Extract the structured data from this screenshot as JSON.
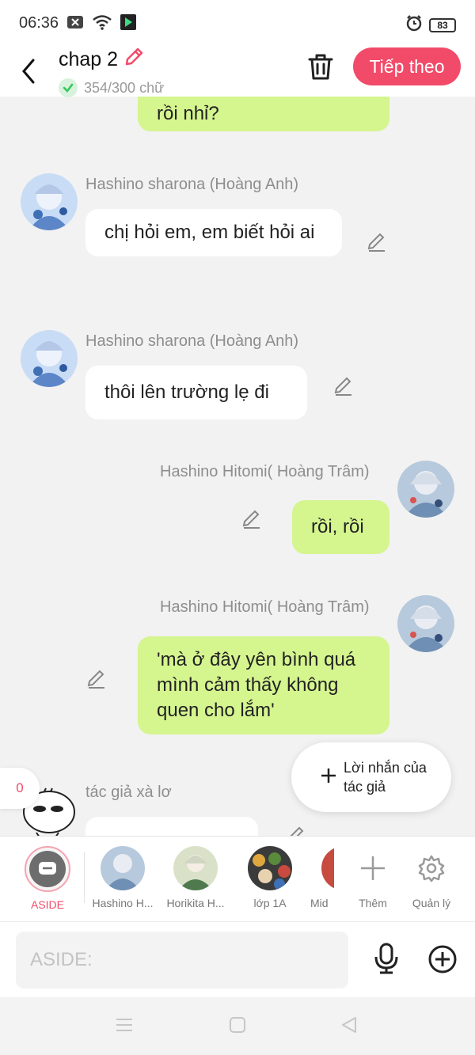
{
  "status": {
    "time": "06:36",
    "battery": "83"
  },
  "header": {
    "title": "chap 2",
    "word_count": "354/300 chữ",
    "next_label": "Tiếp theo"
  },
  "messages": [
    {
      "text": "rồi nhỉ?"
    },
    {
      "name": "Hashino sharona (Hoàng Anh)",
      "text": "chị hỏi em, em biết hỏi ai"
    },
    {
      "name": "Hashino sharona (Hoàng Anh)",
      "text": "thôi lên trường lẹ đi"
    },
    {
      "name": "Hashino Hitomi( Hoàng Trâm)",
      "text": "rồi, rồi"
    },
    {
      "name": "Hashino Hitomi( Hoàng Trâm)",
      "text": "'mà ở đây yên bình quá mình cảm thấy không quen cho lắm'"
    },
    {
      "name": "tác giả xà lơ",
      "text": ""
    }
  ],
  "fab": {
    "label": "Lời nhắn của tác giả"
  },
  "badge_count": "0",
  "characters": [
    {
      "label": "ASIDE"
    },
    {
      "label": "Hashino H..."
    },
    {
      "label": "Horikita H..."
    },
    {
      "label": "lớp 1A"
    },
    {
      "label": "Mid"
    },
    {
      "label": "Thêm"
    },
    {
      "label": "Quản lý"
    }
  ],
  "input": {
    "placeholder": "ASIDE:"
  },
  "colors": {
    "accent": "#f24b6a",
    "green_bubble": "#d5f58f",
    "white_bubble": "#ffffff",
    "background": "#f2f2f2"
  }
}
